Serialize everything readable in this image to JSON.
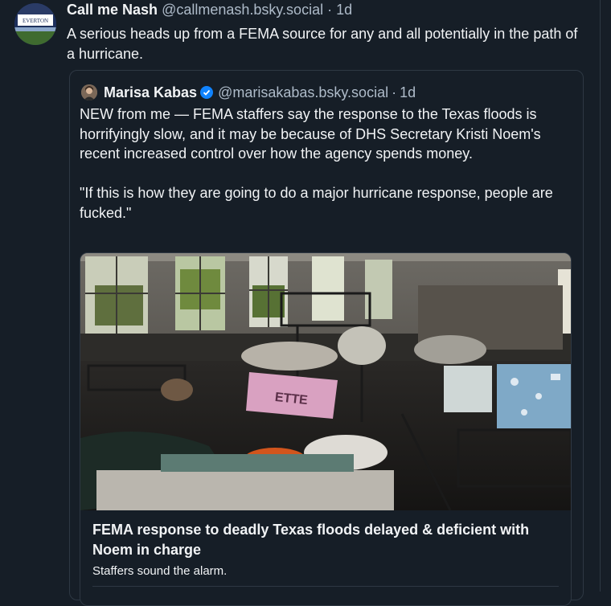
{
  "post": {
    "author_name": "Call me Nash",
    "handle": "@callmenash.bsky.social",
    "separator": "·",
    "time": "1d",
    "text": "A serious heads up from a FEMA source for any and all potentially in the path of a hurricane.",
    "avatar_text": "EVERTON"
  },
  "quote": {
    "author_name": "Marisa Kabas",
    "handle": "@marisakabas.bsky.social",
    "separator": "·",
    "time": "1d",
    "paragraph1": "NEW from me — FEMA staffers say the response to the Texas floods is horrifyingly slow, and it may be because of DHS Secretary Kristi Noem's recent increased control over how the agency spends money.",
    "paragraph2": "\"If this is how they are going to do a major hurricane response, people are fucked.\""
  },
  "link_card": {
    "image_label": "ETTE",
    "title": "FEMA response to deadly Texas floods delayed & deficient with Noem in charge",
    "description": "Staffers sound the alarm."
  },
  "colors": {
    "background": "#161e27",
    "border": "#2e3843",
    "muted_text": "#aebbc9",
    "verified_badge": "#1083fe"
  }
}
